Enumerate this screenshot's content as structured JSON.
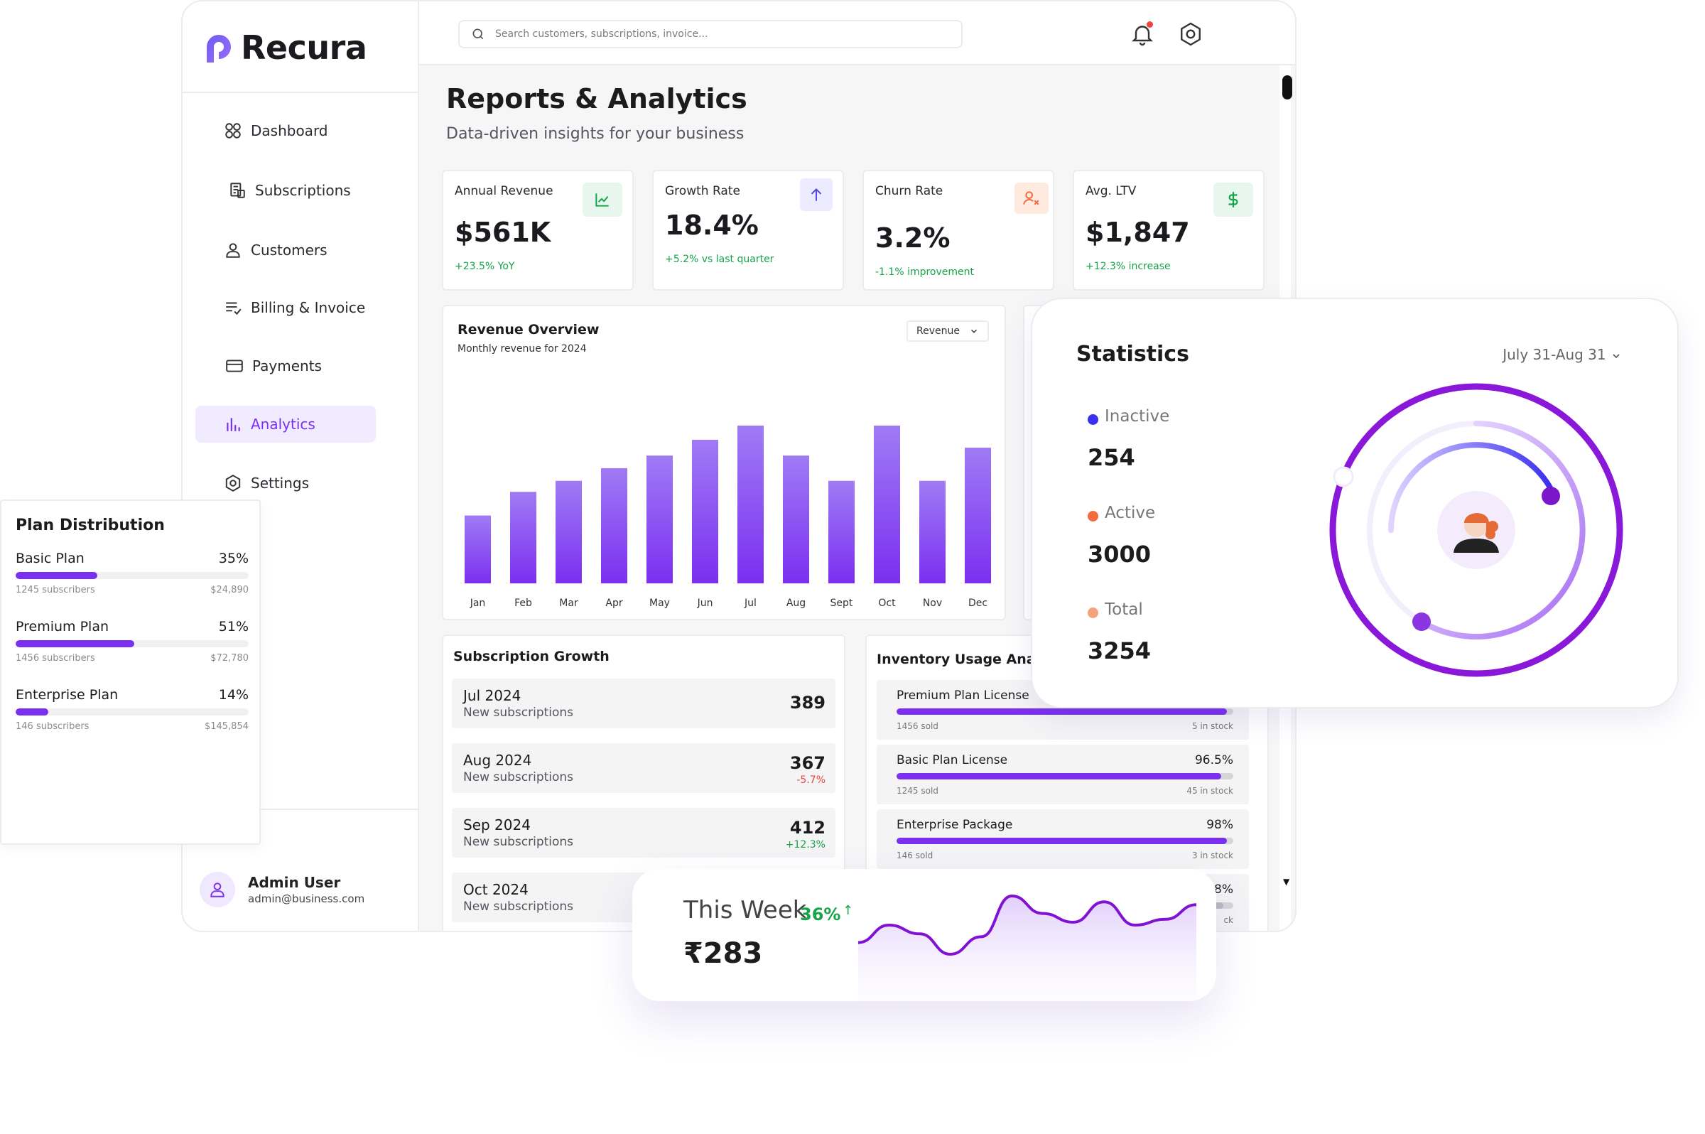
{
  "brand": {
    "name": "Recura"
  },
  "sidebar": {
    "items": [
      {
        "label": "Dashboard",
        "icon": "dashboard-icon"
      },
      {
        "label": "Subscriptions",
        "icon": "subscriptions-icon"
      },
      {
        "label": "Customers",
        "icon": "customers-icon"
      },
      {
        "label": "Billing & Invoice",
        "icon": "billing-icon"
      },
      {
        "label": "Payments",
        "icon": "payments-icon"
      },
      {
        "label": "Analytics",
        "icon": "analytics-icon",
        "active": true
      },
      {
        "label": "Settings",
        "icon": "settings-icon"
      }
    ],
    "user": {
      "name": "Admin User",
      "email": "admin@business.com"
    }
  },
  "topbar": {
    "search_placeholder": "Search customers, subscriptions, invoice..."
  },
  "page": {
    "title": "Reports & Analytics",
    "subtitle": "Data-driven insights for your business"
  },
  "kpis": [
    {
      "label": "Annual Revenue",
      "value": "$561K",
      "change": "+23.5% YoY",
      "icon": "trend-up-icon",
      "color": "#16a34a"
    },
    {
      "label": "Growth Rate",
      "value": "18.4%",
      "change": "+5.2% vs last quarter",
      "icon": "arrow-up-icon",
      "color": "#16a34a"
    },
    {
      "label": "Churn Rate",
      "value": "3.2%",
      "change": "-1.1% improvement",
      "icon": "user-x-icon",
      "color": "#16a34a"
    },
    {
      "label": "Avg. LTV",
      "value": "$1,847",
      "change": "+12.3% increase",
      "icon": "dollar-icon",
      "color": "#16a34a"
    }
  ],
  "revenue_overview": {
    "title": "Revenue Overview",
    "subtitle": "Monthly revenue for 2024",
    "select_value": "Revenue"
  },
  "chart_data": {
    "type": "bar",
    "title": "Revenue Overview",
    "subtitle": "Monthly revenue for 2024",
    "categories": [
      "Jan",
      "Feb",
      "Mar",
      "Apr",
      "May",
      "Jun",
      "Jul",
      "Aug",
      "Sept",
      "Oct",
      "Nov",
      "Dec"
    ],
    "values": [
      43,
      58,
      65,
      73,
      81,
      91,
      100,
      81,
      65,
      100,
      65,
      86
    ],
    "ylim": [
      0,
      100
    ],
    "grid": false,
    "colors": {
      "top": "#a07bf5",
      "bottom": "#7b2ff0"
    }
  },
  "subscription_growth": {
    "title": "Subscription Growth",
    "rows": [
      {
        "month": "Jul 2024",
        "desc": "New subscriptions",
        "count": "389",
        "delta": ""
      },
      {
        "month": "Aug 2024",
        "desc": "New subscriptions",
        "count": "367",
        "delta": "-5.7%",
        "delta_color": "#ef4444"
      },
      {
        "month": "Sep 2024",
        "desc": "New subscriptions",
        "count": "412",
        "delta": "+12.3%",
        "delta_color": "#16a34a"
      },
      {
        "month": "Oct 2024",
        "desc": "New subscriptions",
        "count": "",
        "delta": ""
      }
    ]
  },
  "inventory": {
    "title": "Inventory Usage Analyt",
    "rows": [
      {
        "name": "Premium Plan License",
        "pct": "",
        "fill": 0.98,
        "sold": "1456 sold",
        "stock": "5 in stock"
      },
      {
        "name": "Basic Plan License",
        "pct": "96.5%",
        "fill": 0.965,
        "sold": "1245 sold",
        "stock": "45 in stock"
      },
      {
        "name": "Enterprise Package",
        "pct": "98%",
        "fill": 0.98,
        "sold": "146 sold",
        "stock": "3 in stock"
      }
    ],
    "partial_pct": "8%",
    "partial_stock": "ck"
  },
  "plan_distribution": {
    "title": "Plan Distribution",
    "plans": [
      {
        "name": "Basic Plan",
        "pct": "35%",
        "fill": 0.35,
        "subscribers": "1245 subscribers",
        "revenue": "$24,890"
      },
      {
        "name": "Premium Plan",
        "pct": "51%",
        "fill": 0.51,
        "subscribers": "1456 subscribers",
        "revenue": "$72,780"
      },
      {
        "name": "Enterprise Plan",
        "pct": "14%",
        "fill": 0.14,
        "subscribers": "146 subscribers",
        "revenue": "$145,854"
      }
    ]
  },
  "statistics": {
    "title": "Statistics",
    "range": "July 31-Aug 31",
    "items": [
      {
        "label": "Inactive",
        "value": "254",
        "color": "#3b2ff0"
      },
      {
        "label": "Active",
        "value": "3000",
        "color": "#f26a3d"
      },
      {
        "label": "Total",
        "value": "3254",
        "color": "#f5a27c"
      }
    ]
  },
  "this_week": {
    "title": "This Week",
    "pct": "36%",
    "value": "₹283",
    "series": [
      12,
      18,
      15,
      8,
      14,
      28,
      22,
      19,
      26,
      18,
      20,
      25
    ]
  }
}
